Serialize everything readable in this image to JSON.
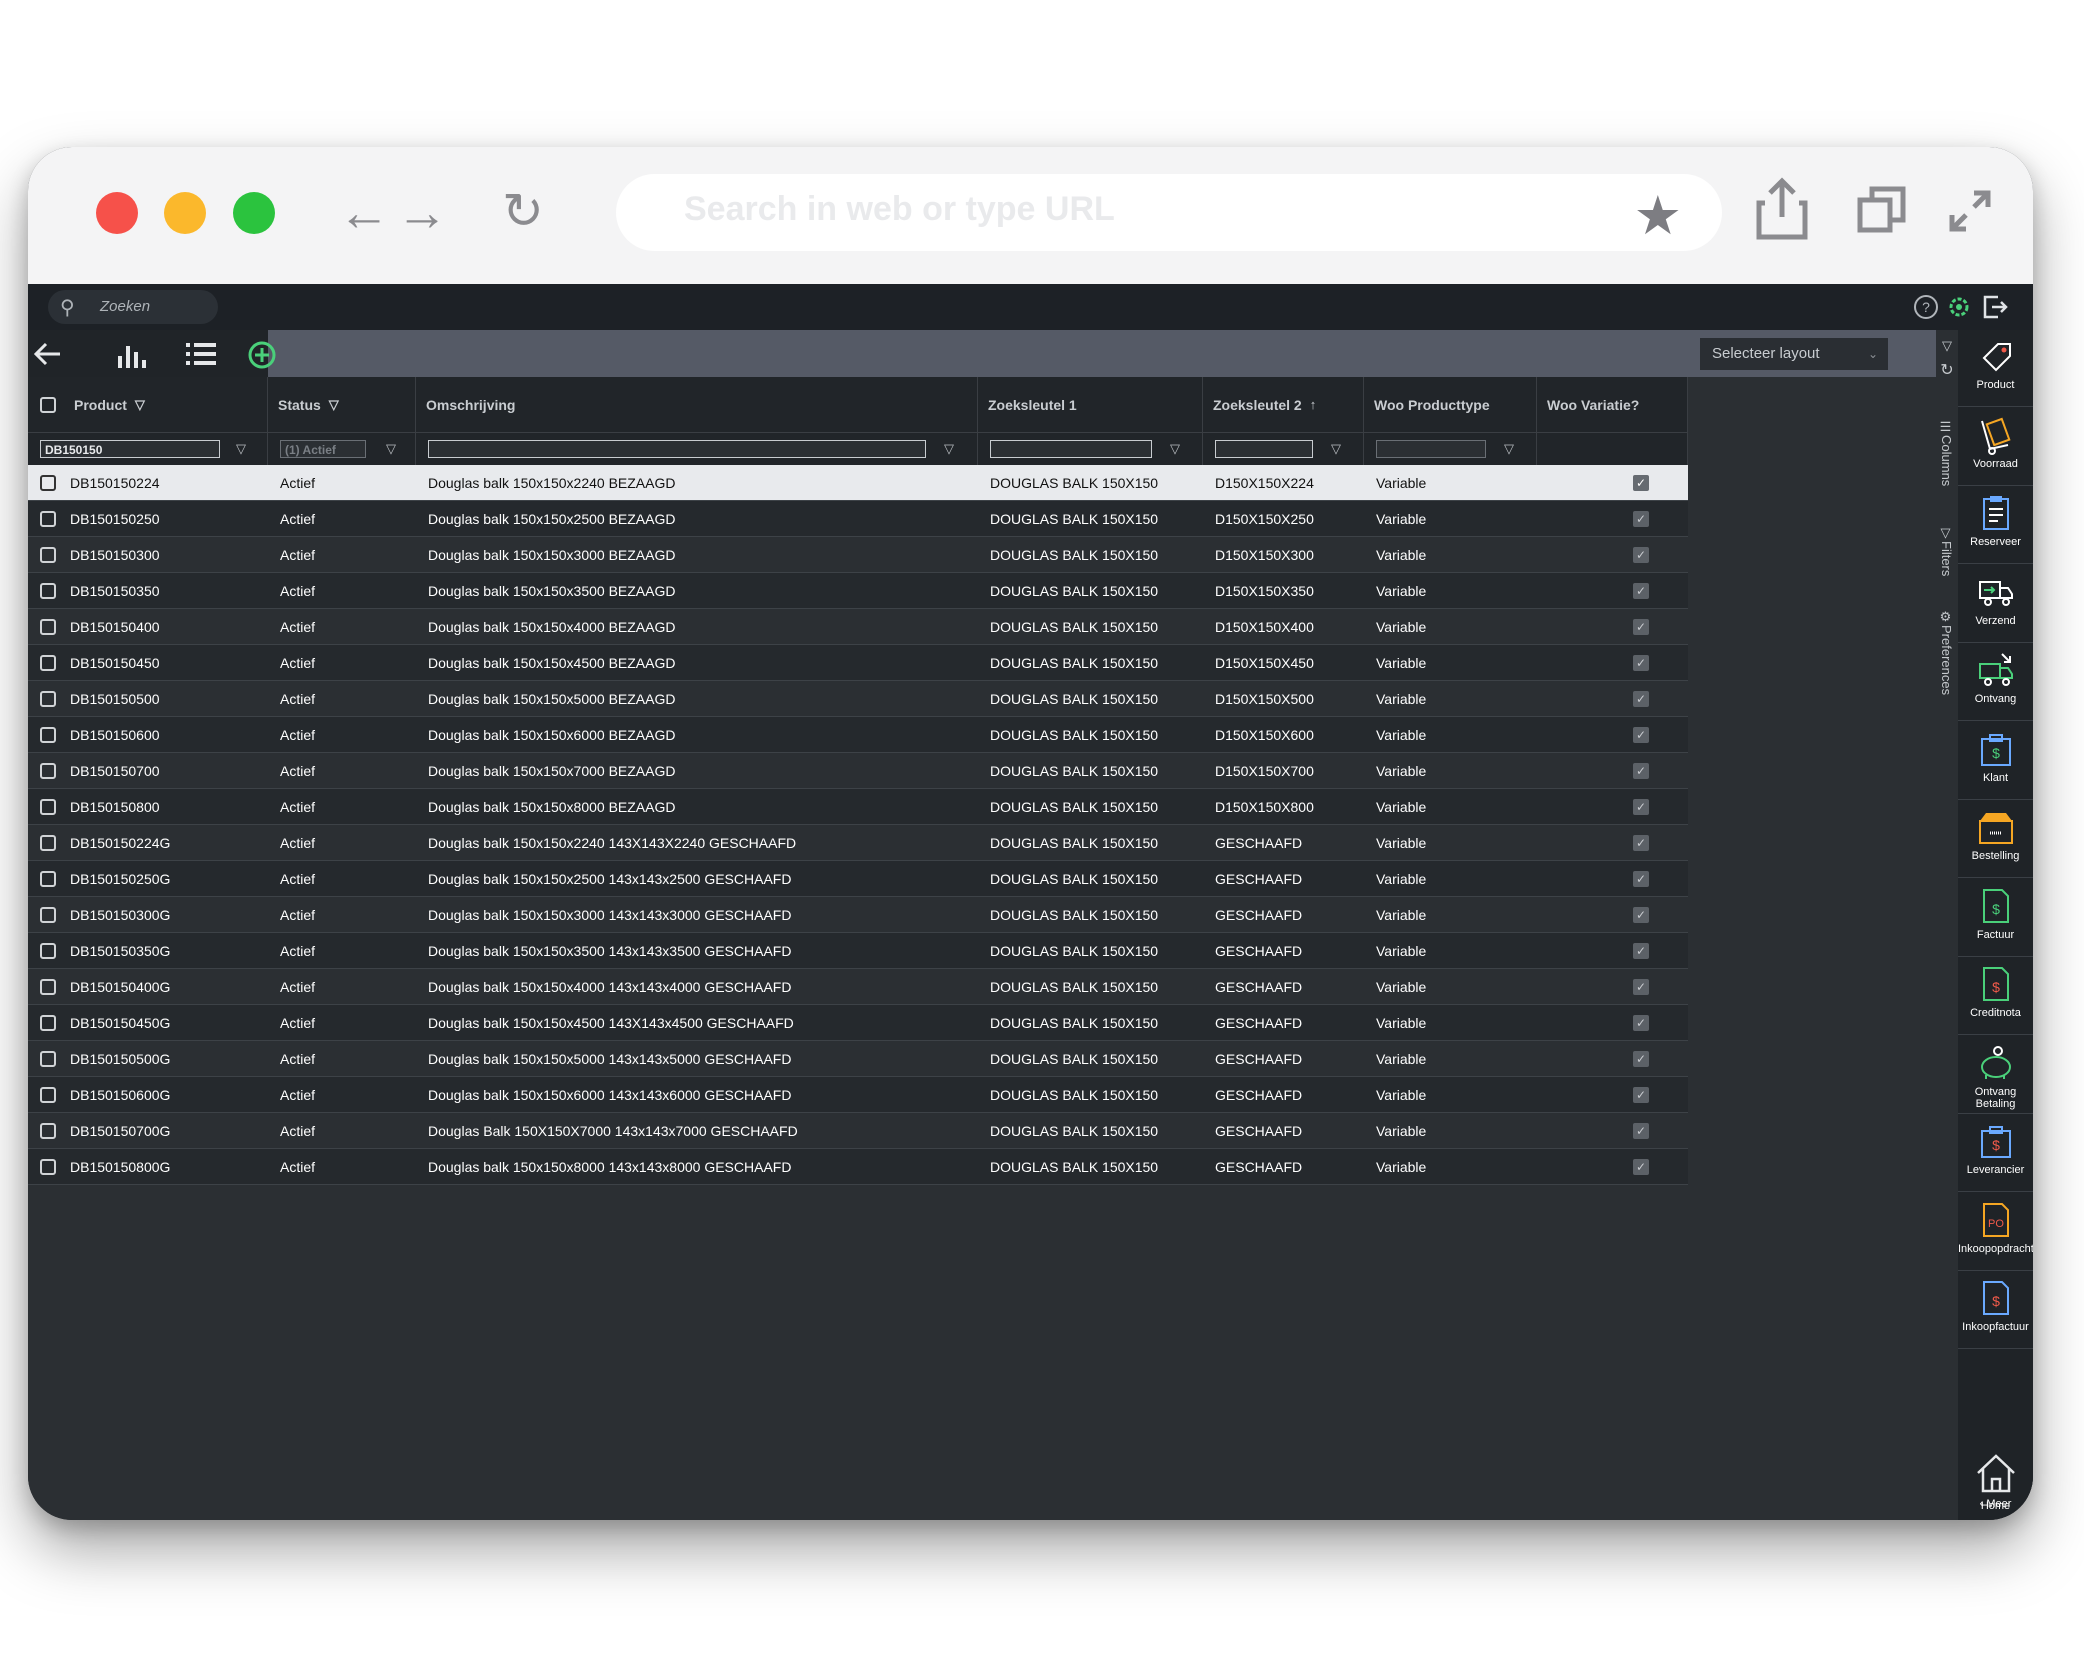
{
  "browser": {
    "url_placeholder": "Search in web or type URL",
    "nav_back": "←",
    "nav_forward": "→",
    "reload": "↻",
    "star": "★"
  },
  "app": {
    "search_placeholder": "Zoeken",
    "layout_select": "Selecteer layout",
    "accent_green": "#4ad07a",
    "accent_red": "#f05a4a"
  },
  "columns": [
    {
      "label": "Product",
      "filter": "DB150150",
      "has_filter_icon": true
    },
    {
      "label": "Status",
      "filter": "(1) Actief",
      "has_filter_icon": true
    },
    {
      "label": "Omschrijving",
      "filter": ""
    },
    {
      "label": "Zoeksleutel 1",
      "filter": ""
    },
    {
      "label": "Zoeksleutel 2",
      "filter": "",
      "sort": "↑"
    },
    {
      "label": "Woo Producttype",
      "filter": ""
    },
    {
      "label": "Woo Variatie?"
    }
  ],
  "rows": [
    {
      "product": "DB150150224",
      "status": "Actief",
      "omschrijving": "Douglas balk 150x150x2240 BEZAAGD",
      "zk1": "DOUGLAS BALK 150X150",
      "zk2": "D150X150X224",
      "type": "Variable",
      "variatie": true
    },
    {
      "product": "DB150150250",
      "status": "Actief",
      "omschrijving": "Douglas balk 150x150x2500 BEZAAGD",
      "zk1": "DOUGLAS BALK 150X150",
      "zk2": "D150X150X250",
      "type": "Variable",
      "variatie": true
    },
    {
      "product": "DB150150300",
      "status": "Actief",
      "omschrijving": "Douglas balk 150x150x3000 BEZAAGD",
      "zk1": "DOUGLAS BALK 150X150",
      "zk2": "D150X150X300",
      "type": "Variable",
      "variatie": true
    },
    {
      "product": "DB150150350",
      "status": "Actief",
      "omschrijving": "Douglas balk 150x150x3500 BEZAAGD",
      "zk1": "DOUGLAS BALK 150X150",
      "zk2": "D150X150X350",
      "type": "Variable",
      "variatie": true
    },
    {
      "product": "DB150150400",
      "status": "Actief",
      "omschrijving": "Douglas balk 150x150x4000 BEZAAGD",
      "zk1": "DOUGLAS BALK 150X150",
      "zk2": "D150X150X400",
      "type": "Variable",
      "variatie": true
    },
    {
      "product": "DB150150450",
      "status": "Actief",
      "omschrijving": "Douglas balk 150x150x4500 BEZAAGD",
      "zk1": "DOUGLAS BALK 150X150",
      "zk2": "D150X150X450",
      "type": "Variable",
      "variatie": true
    },
    {
      "product": "DB150150500",
      "status": "Actief",
      "omschrijving": "Douglas balk 150x150x5000 BEZAAGD",
      "zk1": "DOUGLAS BALK 150X150",
      "zk2": "D150X150X500",
      "type": "Variable",
      "variatie": true
    },
    {
      "product": "DB150150600",
      "status": "Actief",
      "omschrijving": "Douglas balk 150x150x6000 BEZAAGD",
      "zk1": "DOUGLAS BALK 150X150",
      "zk2": "D150X150X600",
      "type": "Variable",
      "variatie": true
    },
    {
      "product": "DB150150700",
      "status": "Actief",
      "omschrijving": "Douglas balk 150x150x7000 BEZAAGD",
      "zk1": "DOUGLAS BALK 150X150",
      "zk2": "D150X150X700",
      "type": "Variable",
      "variatie": true
    },
    {
      "product": "DB150150800",
      "status": "Actief",
      "omschrijving": "Douglas balk 150x150x8000 BEZAAGD",
      "zk1": "DOUGLAS BALK 150X150",
      "zk2": "D150X150X800",
      "type": "Variable",
      "variatie": true
    },
    {
      "product": "DB150150224G",
      "status": "Actief",
      "omschrijving": "Douglas balk 150x150x2240 143X143X2240 GESCHAAFD",
      "zk1": "DOUGLAS BALK 150X150",
      "zk2": "GESCHAAFD",
      "type": "Variable",
      "variatie": true
    },
    {
      "product": "DB150150250G",
      "status": "Actief",
      "omschrijving": "Douglas balk 150x150x2500 143x143x2500 GESCHAAFD",
      "zk1": "DOUGLAS BALK 150X150",
      "zk2": "GESCHAAFD",
      "type": "Variable",
      "variatie": true
    },
    {
      "product": "DB150150300G",
      "status": "Actief",
      "omschrijving": "Douglas balk 150x150x3000 143x143x3000 GESCHAAFD",
      "zk1": "DOUGLAS BALK 150X150",
      "zk2": "GESCHAAFD",
      "type": "Variable",
      "variatie": true
    },
    {
      "product": "DB150150350G",
      "status": "Actief",
      "omschrijving": "Douglas balk 150x150x3500 143x143x3500 GESCHAAFD",
      "zk1": "DOUGLAS BALK 150X150",
      "zk2": "GESCHAAFD",
      "type": "Variable",
      "variatie": true
    },
    {
      "product": "DB150150400G",
      "status": "Actief",
      "omschrijving": "Douglas balk 150x150x4000 143x143x4000 GESCHAAFD",
      "zk1": "DOUGLAS BALK 150X150",
      "zk2": "GESCHAAFD",
      "type": "Variable",
      "variatie": true
    },
    {
      "product": "DB150150450G",
      "status": "Actief",
      "omschrijving": "Douglas balk 150x150x4500 143X143x4500 GESCHAAFD",
      "zk1": "DOUGLAS BALK 150X150",
      "zk2": "GESCHAAFD",
      "type": "Variable",
      "variatie": true
    },
    {
      "product": "DB150150500G",
      "status": "Actief",
      "omschrijving": "Douglas balk 150x150x5000 143x143x5000 GESCHAAFD",
      "zk1": "DOUGLAS BALK 150X150",
      "zk2": "GESCHAAFD",
      "type": "Variable",
      "variatie": true
    },
    {
      "product": "DB150150600G",
      "status": "Actief",
      "omschrijving": "Douglas balk 150x150x6000 143x143x6000 GESCHAAFD",
      "zk1": "DOUGLAS BALK 150X150",
      "zk2": "GESCHAAFD",
      "type": "Variable",
      "variatie": true
    },
    {
      "product": "DB150150700G",
      "status": "Actief",
      "omschrijving": "Douglas Balk 150X150X7000 143x143x7000 GESCHAAFD",
      "zk1": "DOUGLAS BALK 150X150",
      "zk2": "GESCHAAFD",
      "type": "Variable",
      "variatie": true
    },
    {
      "product": "DB150150800G",
      "status": "Actief",
      "omschrijving": "Douglas balk 150x150x8000 143x143x8000 GESCHAAFD",
      "zk1": "DOUGLAS BALK 150X150",
      "zk2": "GESCHAAFD",
      "type": "Variable",
      "variatie": true
    }
  ],
  "side_tabs": [
    "Columns",
    "Filters",
    "Preferences"
  ],
  "right_nav": [
    {
      "label": "Product",
      "icon": "tag-icon"
    },
    {
      "label": "Voorraad",
      "icon": "hand-truck-icon"
    },
    {
      "label": "Reserveer",
      "icon": "clipboard-icon"
    },
    {
      "label": "Verzend",
      "icon": "truck-out-icon"
    },
    {
      "label": "Ontvang",
      "icon": "truck-in-icon"
    },
    {
      "label": "Klant",
      "icon": "customer-folder-icon"
    },
    {
      "label": "Bestelling",
      "icon": "order-box-icon"
    },
    {
      "label": "Factuur",
      "icon": "invoice-icon"
    },
    {
      "label": "Creditnota",
      "icon": "credit-note-icon"
    },
    {
      "label": "Ontvang Betaling",
      "icon": "piggy-bank-icon"
    },
    {
      "label": "Leverancier",
      "icon": "supplier-folder-icon"
    },
    {
      "label": "Inkoopopdracht",
      "icon": "purchase-order-icon"
    },
    {
      "label": "Inkoopfactuur",
      "icon": "purchase-invoice-icon"
    }
  ],
  "home_label": "Home",
  "meer_label": "‹ Meer"
}
